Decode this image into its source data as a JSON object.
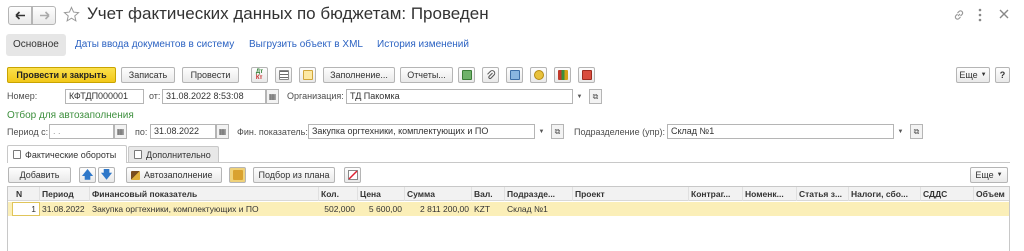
{
  "window": {
    "title": "Учет фактических данных по бюджетам: Проведен"
  },
  "nav_tabs": [
    {
      "label": "Основное"
    },
    {
      "label": "Даты ввода документов в систему"
    },
    {
      "label": "Выгрузить объект в XML"
    },
    {
      "label": "История изменений"
    }
  ],
  "toolbar": {
    "post_close": "Провести и закрыть",
    "save": "Записать",
    "post": "Провести",
    "fill": "Заполнение...",
    "reports": "Отчеты...",
    "more": "Еще"
  },
  "header": {
    "number_label": "Номер:",
    "number_value": "КФТДП000001",
    "from_label": "от:",
    "date_value": "31.08.2022  8:53:08",
    "org_label": "Организация:",
    "org_value": "ТД Пакомка"
  },
  "filter": {
    "section_title": "Отбор для автозаполнения",
    "period_from_label": "Период с:",
    "period_from_value": " .  .",
    "period_to_label": "по:",
    "period_to_value": "31.08.2022",
    "fin_label": "Фин. показатель:",
    "fin_value": "Закупка оргтехники, комплектующих и ПО",
    "dept_label": "Подразделение (упр):",
    "dept_value": "Склад №1"
  },
  "form_tabs": [
    {
      "label": "Фактические обороты"
    },
    {
      "label": "Дополнительно"
    }
  ],
  "table_toolbar": {
    "add": "Добавить",
    "autofill": "Автозаполнение",
    "select_from_plan": "Подбор из плана",
    "more": "Еще"
  },
  "table": {
    "headers": [
      "N",
      "Период",
      "Финансовый показатель",
      "Кол.",
      "Цена",
      "Сумма",
      "Вал.",
      "Подразде...",
      "Проект",
      "Контраг...",
      "Номенк...",
      "Статья з...",
      "Налоги, сбо...",
      "СДДС",
      "Объем"
    ],
    "rows": [
      [
        "1",
        "31.08.2022",
        "Закупка оргтехники, комплектующих и ПО",
        "502,000",
        "5 600,00",
        "2 811 200,00",
        "KZT",
        "Склад №1",
        "",
        "",
        "",
        "",
        "",
        "",
        ""
      ]
    ]
  },
  "colors": {
    "accent_yellow": "#f7d631",
    "selected_row": "#fbefb8",
    "link_blue": "#2b62c2",
    "section_green": "#3d8f3d"
  }
}
